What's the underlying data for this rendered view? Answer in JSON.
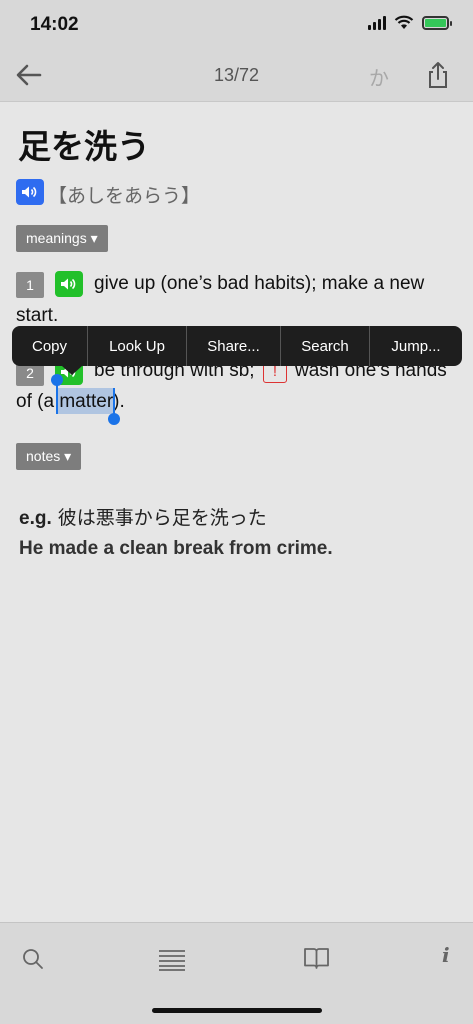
{
  "status_bar": {
    "time": "14:02",
    "icons": [
      "signal-icon",
      "wifi-icon",
      "battery-charging-icon"
    ],
    "battery_color": "#34c759"
  },
  "nav": {
    "back_icon": "arrow-left-icon",
    "position": "13/72",
    "kana_toggle": "か",
    "share_icon": "share-icon"
  },
  "entry": {
    "headword": "足を洗う",
    "reading": "【あしをあらう】",
    "meanings_label": "meanings ▾",
    "notes_label": "notes ▾",
    "senses": [
      {
        "number": "1",
        "line1": "give up (one’s bad habits); make a new",
        "line2": "start."
      },
      {
        "number": "2",
        "line1a": "be through with sb;",
        "line1_marker": "!",
        "line1b": "wash one’s hands",
        "line2_prefix": "of (a ",
        "line2_selected": "matter",
        "line2_suffix": ")."
      }
    ],
    "example": {
      "label": "e.g.",
      "japanese": "彼は悪事から足を洗った",
      "english": "He made a clean break from crime."
    },
    "colors": {
      "audio_blue": "#2f6cf0",
      "audio_green": "#22c02a",
      "selection": "#1a73e8"
    }
  },
  "context_menu": {
    "items": [
      "Copy",
      "Look Up",
      "Share...",
      "Search",
      "Jump..."
    ]
  },
  "tab_bar": {
    "icons": [
      "search-icon",
      "list-icon",
      "book-icon",
      "info-icon"
    ],
    "info_glyph": "i"
  }
}
